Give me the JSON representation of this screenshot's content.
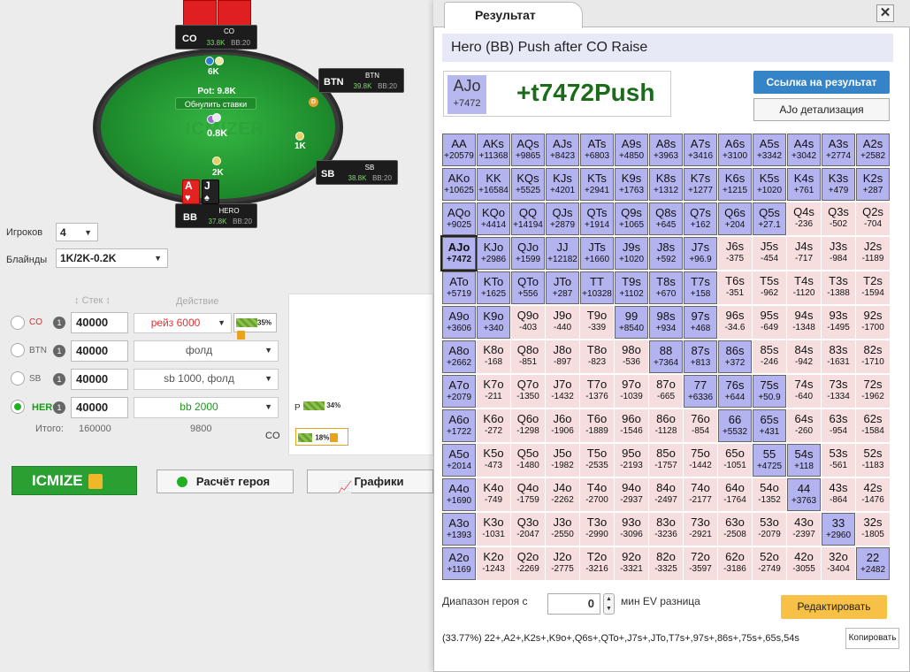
{
  "table": {
    "seats": {
      "co": {
        "name": "CO",
        "player": "CO",
        "stack": "33.8K",
        "bb": "BB:20"
      },
      "btn": {
        "name": "BTN",
        "player": "BTN",
        "stack": "39.8K",
        "bb": "BB:20"
      },
      "sb": {
        "name": "SB",
        "player": "SB",
        "stack": "38.8K",
        "bb": "BB:20"
      },
      "bb": {
        "name": "BB",
        "player": "HERO",
        "stack": "37.8K",
        "bb": "BB:20"
      }
    },
    "co_bet": "6K",
    "pot_label": "Pot: 9.8K",
    "zero_bets_label": "Обнулить ставки",
    "center_bet": "0.8K",
    "sb_bet": "1K",
    "bb_bet": "2K",
    "dealer": "D",
    "logo": "ICMIZER",
    "hero_cards": [
      "A",
      "J"
    ]
  },
  "settings": {
    "players_label": "Игроков",
    "players_value": "4",
    "blinds_label": "Блайнды",
    "blinds_value": "1K/2K-0.2K"
  },
  "columns": {
    "stack": "Стек",
    "action": "Действие"
  },
  "rows": [
    {
      "pos": "CO",
      "num": "1",
      "stack": "40000",
      "action": "рейз 6000",
      "pct": "35%",
      "selected": false
    },
    {
      "pos": "BTN",
      "num": "1",
      "stack": "40000",
      "action": "фолд",
      "pct": "",
      "selected": false
    },
    {
      "pos": "SB",
      "num": "1",
      "stack": "40000",
      "action": "sb 1000, фолд",
      "pct": "",
      "selected": false
    },
    {
      "pos": "HERO",
      "num": "1",
      "stack": "40000",
      "action": "bb 2000",
      "pct": "",
      "selected": true
    }
  ],
  "totals": {
    "label": "Итого:",
    "stack": "160000",
    "action": "9800"
  },
  "side": {
    "p_label": "P",
    "p_pct": "34%",
    "co_label": "CO",
    "co_pct": "18%"
  },
  "buttons": {
    "icmize": "ICMIZE",
    "hero_calc": "Расчёт героя",
    "graphs": "Графики"
  },
  "result": {
    "tab": "Результат",
    "close": "✕",
    "title": "Hero (BB) Push after CO Raise",
    "hand": "AJo",
    "hand_ev": "+7472",
    "ev_value": "+t7472Push",
    "link_button": "Ссылка на результат",
    "detail_button": "AJo детализация",
    "range_label": "Диапазон героя с",
    "range_value": "0",
    "range_suffix": "мин EV разница",
    "edit_button": "Редактировать",
    "range_text": "(33.77%) 22+,A2+,K2s+,K9o+,Q6s+,QTo+,J7s+,JTo,T7s+,97s+,86s+,75s+,65s,54s",
    "copy_button": "Копировать"
  },
  "grid": [
    [
      [
        "AA",
        "+20579",
        "p"
      ],
      [
        "AKs",
        "+11368",
        "p"
      ],
      [
        "AQs",
        "+9865",
        "p"
      ],
      [
        "AJs",
        "+8423",
        "p"
      ],
      [
        "ATs",
        "+6803",
        "p"
      ],
      [
        "A9s",
        "+4850",
        "p"
      ],
      [
        "A8s",
        "+3963",
        "p"
      ],
      [
        "A7s",
        "+3416",
        "p"
      ],
      [
        "A6s",
        "+3100",
        "p"
      ],
      [
        "A5s",
        "+3342",
        "p"
      ],
      [
        "A4s",
        "+3042",
        "p"
      ],
      [
        "A3s",
        "+2774",
        "p"
      ],
      [
        "A2s",
        "+2582",
        "p"
      ]
    ],
    [
      [
        "AKo",
        "+10625",
        "p"
      ],
      [
        "KK",
        "+16584",
        "p"
      ],
      [
        "KQs",
        "+5525",
        "p"
      ],
      [
        "KJs",
        "+4201",
        "p"
      ],
      [
        "KTs",
        "+2941",
        "p"
      ],
      [
        "K9s",
        "+1763",
        "p"
      ],
      [
        "K8s",
        "+1312",
        "p"
      ],
      [
        "K7s",
        "+1277",
        "p"
      ],
      [
        "K6s",
        "+1215",
        "p"
      ],
      [
        "K5s",
        "+1020",
        "p"
      ],
      [
        "K4s",
        "+761",
        "p"
      ],
      [
        "K3s",
        "+479",
        "p"
      ],
      [
        "K2s",
        "+287",
        "p"
      ]
    ],
    [
      [
        "AQo",
        "+9025",
        "p"
      ],
      [
        "KQo",
        "+4414",
        "p"
      ],
      [
        "QQ",
        "+14194",
        "p"
      ],
      [
        "QJs",
        "+2879",
        "p"
      ],
      [
        "QTs",
        "+1914",
        "p"
      ],
      [
        "Q9s",
        "+1065",
        "p"
      ],
      [
        "Q8s",
        "+645",
        "p"
      ],
      [
        "Q7s",
        "+162",
        "p"
      ],
      [
        "Q6s",
        "+204",
        "p"
      ],
      [
        "Q5s",
        "+27.1",
        "p"
      ],
      [
        "Q4s",
        "-236",
        "f"
      ],
      [
        "Q3s",
        "-502",
        "f"
      ],
      [
        "Q2s",
        "-704",
        "f"
      ]
    ],
    [
      [
        "AJo",
        "+7472",
        "s"
      ],
      [
        "KJo",
        "+2986",
        "p"
      ],
      [
        "QJo",
        "+1599",
        "p"
      ],
      [
        "JJ",
        "+12182",
        "p"
      ],
      [
        "JTs",
        "+1660",
        "p"
      ],
      [
        "J9s",
        "+1020",
        "p"
      ],
      [
        "J8s",
        "+592",
        "p"
      ],
      [
        "J7s",
        "+96.9",
        "p"
      ],
      [
        "J6s",
        "-375",
        "f"
      ],
      [
        "J5s",
        "-454",
        "f"
      ],
      [
        "J4s",
        "-717",
        "f"
      ],
      [
        "J3s",
        "-984",
        "f"
      ],
      [
        "J2s",
        "-1189",
        "f"
      ]
    ],
    [
      [
        "ATo",
        "+5719",
        "p"
      ],
      [
        "KTo",
        "+1625",
        "p"
      ],
      [
        "QTo",
        "+556",
        "p"
      ],
      [
        "JTo",
        "+287",
        "p"
      ],
      [
        "TT",
        "+10328",
        "p"
      ],
      [
        "T9s",
        "+1102",
        "p"
      ],
      [
        "T8s",
        "+670",
        "p"
      ],
      [
        "T7s",
        "+158",
        "p"
      ],
      [
        "T6s",
        "-351",
        "f"
      ],
      [
        "T5s",
        "-962",
        "f"
      ],
      [
        "T4s",
        "-1120",
        "f"
      ],
      [
        "T3s",
        "-1388",
        "f"
      ],
      [
        "T2s",
        "-1594",
        "f"
      ]
    ],
    [
      [
        "A9o",
        "+3606",
        "p"
      ],
      [
        "K9o",
        "+340",
        "p"
      ],
      [
        "Q9o",
        "-403",
        "f"
      ],
      [
        "J9o",
        "-440",
        "f"
      ],
      [
        "T9o",
        "-339",
        "f"
      ],
      [
        "99",
        "+8540",
        "p"
      ],
      [
        "98s",
        "+934",
        "p"
      ],
      [
        "97s",
        "+468",
        "p"
      ],
      [
        "96s",
        "-34.6",
        "f"
      ],
      [
        "95s",
        "-649",
        "f"
      ],
      [
        "94s",
        "-1348",
        "f"
      ],
      [
        "93s",
        "-1495",
        "f"
      ],
      [
        "92s",
        "-1700",
        "f"
      ]
    ],
    [
      [
        "A8o",
        "+2662",
        "p"
      ],
      [
        "K8o",
        "-168",
        "f"
      ],
      [
        "Q8o",
        "-851",
        "f"
      ],
      [
        "J8o",
        "-897",
        "f"
      ],
      [
        "T8o",
        "-823",
        "f"
      ],
      [
        "98o",
        "-536",
        "f"
      ],
      [
        "88",
        "+7364",
        "p"
      ],
      [
        "87s",
        "+813",
        "p"
      ],
      [
        "86s",
        "+372",
        "p"
      ],
      [
        "85s",
        "-246",
        "f"
      ],
      [
        "84s",
        "-942",
        "f"
      ],
      [
        "83s",
        "-1631",
        "f"
      ],
      [
        "82s",
        "-1710",
        "f"
      ]
    ],
    [
      [
        "A7o",
        "+2079",
        "p"
      ],
      [
        "K7o",
        "-211",
        "f"
      ],
      [
        "Q7o",
        "-1350",
        "f"
      ],
      [
        "J7o",
        "-1432",
        "f"
      ],
      [
        "T7o",
        "-1376",
        "f"
      ],
      [
        "97o",
        "-1039",
        "f"
      ],
      [
        "87o",
        "-665",
        "f"
      ],
      [
        "77",
        "+6336",
        "p"
      ],
      [
        "76s",
        "+644",
        "p"
      ],
      [
        "75s",
        "+50.9",
        "p"
      ],
      [
        "74s",
        "-640",
        "f"
      ],
      [
        "73s",
        "-1334",
        "f"
      ],
      [
        "72s",
        "-1962",
        "f"
      ]
    ],
    [
      [
        "A6o",
        "+1722",
        "p"
      ],
      [
        "K6o",
        "-272",
        "f"
      ],
      [
        "Q6o",
        "-1298",
        "f"
      ],
      [
        "J6o",
        "-1906",
        "f"
      ],
      [
        "T6o",
        "-1889",
        "f"
      ],
      [
        "96o",
        "-1546",
        "f"
      ],
      [
        "86o",
        "-1128",
        "f"
      ],
      [
        "76o",
        "-854",
        "f"
      ],
      [
        "66",
        "+5532",
        "p"
      ],
      [
        "65s",
        "+431",
        "p"
      ],
      [
        "64s",
        "-260",
        "f"
      ],
      [
        "63s",
        "-954",
        "f"
      ],
      [
        "62s",
        "-1584",
        "f"
      ]
    ],
    [
      [
        "A5o",
        "+2014",
        "p"
      ],
      [
        "K5o",
        "-473",
        "f"
      ],
      [
        "Q5o",
        "-1480",
        "f"
      ],
      [
        "J5o",
        "-1982",
        "f"
      ],
      [
        "T5o",
        "-2535",
        "f"
      ],
      [
        "95o",
        "-2193",
        "f"
      ],
      [
        "85o",
        "-1757",
        "f"
      ],
      [
        "75o",
        "-1442",
        "f"
      ],
      [
        "65o",
        "-1051",
        "f"
      ],
      [
        "55",
        "+4725",
        "p"
      ],
      [
        "54s",
        "+118",
        "p"
      ],
      [
        "53s",
        "-561",
        "f"
      ],
      [
        "52s",
        "-1183",
        "f"
      ]
    ],
    [
      [
        "A4o",
        "+1690",
        "p"
      ],
      [
        "K4o",
        "-749",
        "f"
      ],
      [
        "Q4o",
        "-1759",
        "f"
      ],
      [
        "J4o",
        "-2262",
        "f"
      ],
      [
        "T4o",
        "-2700",
        "f"
      ],
      [
        "94o",
        "-2937",
        "f"
      ],
      [
        "84o",
        "-2497",
        "f"
      ],
      [
        "74o",
        "-2177",
        "f"
      ],
      [
        "64o",
        "-1764",
        "f"
      ],
      [
        "54o",
        "-1352",
        "f"
      ],
      [
        "44",
        "+3763",
        "p"
      ],
      [
        "43s",
        "-864",
        "f"
      ],
      [
        "42s",
        "-1476",
        "f"
      ]
    ],
    [
      [
        "A3o",
        "+1393",
        "p"
      ],
      [
        "K3o",
        "-1031",
        "f"
      ],
      [
        "Q3o",
        "-2047",
        "f"
      ],
      [
        "J3o",
        "-2550",
        "f"
      ],
      [
        "T3o",
        "-2990",
        "f"
      ],
      [
        "93o",
        "-3096",
        "f"
      ],
      [
        "83o",
        "-3236",
        "f"
      ],
      [
        "73o",
        "-2921",
        "f"
      ],
      [
        "63o",
        "-2508",
        "f"
      ],
      [
        "53o",
        "-2079",
        "f"
      ],
      [
        "43o",
        "-2397",
        "f"
      ],
      [
        "33",
        "+2960",
        "p"
      ],
      [
        "32s",
        "-1805",
        "f"
      ]
    ],
    [
      [
        "A2o",
        "+1169",
        "p"
      ],
      [
        "K2o",
        "-1243",
        "f"
      ],
      [
        "Q2o",
        "-2269",
        "f"
      ],
      [
        "J2o",
        "-2775",
        "f"
      ],
      [
        "T2o",
        "-3216",
        "f"
      ],
      [
        "92o",
        "-3321",
        "f"
      ],
      [
        "82o",
        "-3325",
        "f"
      ],
      [
        "72o",
        "-3597",
        "f"
      ],
      [
        "62o",
        "-3186",
        "f"
      ],
      [
        "52o",
        "-2749",
        "f"
      ],
      [
        "42o",
        "-3055",
        "f"
      ],
      [
        "32o",
        "-3404",
        "f"
      ],
      [
        "22",
        "+2482",
        "p"
      ]
    ]
  ]
}
